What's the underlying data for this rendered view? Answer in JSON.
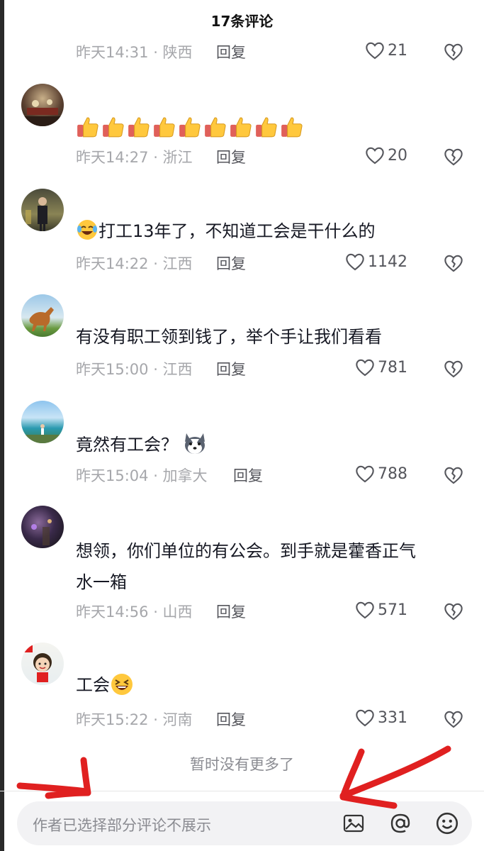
{
  "header": {
    "title": "17条评论"
  },
  "comments": [
    {
      "text": "",
      "time": "昨天14:31 · 陕西",
      "reply": "回复",
      "likes": "21",
      "avatar": "none"
    },
    {
      "text": "",
      "time": "昨天14:27 · 浙江",
      "reply": "回复",
      "likes": "20",
      "emoji_count": 9,
      "avatar": "banquet-room-photo"
    },
    {
      "text": "打工13年了，不知道工会是干什么的",
      "time": "昨天14:22 · 江西",
      "reply": "回复",
      "likes": "1142",
      "leading_emoji": "laughing-crying-emoji",
      "avatar": "man-in-suit-photo"
    },
    {
      "text": "有没有职工领到钱了，举个手让我们看看",
      "time": "昨天15:00 · 江西",
      "reply": "回复",
      "likes": "781",
      "avatar": "horse-photo"
    },
    {
      "text": "竟然有工会？",
      "time": "昨天15:04 · 加拿大",
      "reply": "回复",
      "likes": "788",
      "trailing_emoji": "husky-dog-emoji",
      "avatar": "seaside-photo"
    },
    {
      "text_line1": "想领，你们单位的有公会。到手就是藿香正气",
      "text_line2": "水一箱",
      "time": "昨天14:56 · 山西",
      "reply": "回复",
      "likes": "571",
      "avatar": "night-light-photo"
    },
    {
      "text": "工会",
      "time": "昨天15:22 · 河南",
      "reply": "回复",
      "likes": "331",
      "trailing_emoji": "grinning-squint-emoji",
      "avatar": "cartoon-girl-flag"
    }
  ],
  "footer": {
    "no_more": "暂时没有更多了",
    "input_placeholder": "作者已选择部分评论不展示"
  },
  "colors": {
    "annotation_arrows": "#e02020",
    "meta_gray": "#a6a7ab"
  }
}
